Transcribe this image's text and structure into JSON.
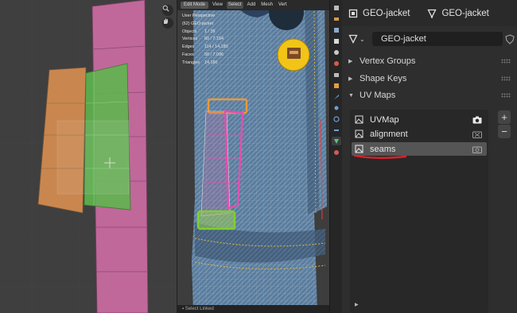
{
  "viewport": {
    "mode": "Edit Mode",
    "menus": [
      "View",
      "Select",
      "Add",
      "Mesh",
      "Vert"
    ],
    "overlay_title": "User Perspective",
    "overlay_object": "(62) GEO-jacket",
    "stats": [
      {
        "label": "Objects",
        "value": "1 / 39"
      },
      {
        "label": "Vertices",
        "value": "60 / 7,154"
      },
      {
        "label": "Edges",
        "value": "114 / 14,180"
      },
      {
        "label": "Faces",
        "value": "58 / 7,096"
      },
      {
        "label": "Triangles",
        "value": "14,180"
      }
    ],
    "footer": "Select Linked"
  },
  "properties": {
    "header_object": "GEO-jacket",
    "header_data": "GEO-jacket",
    "mesh_name": "GEO-jacket",
    "panels": [
      {
        "label": "Vertex Groups",
        "expanded": false
      },
      {
        "label": "Shape Keys",
        "expanded": false
      },
      {
        "label": "UV Maps",
        "expanded": true
      }
    ],
    "uv_maps": [
      {
        "name": "UVMap",
        "active_render": true
      },
      {
        "name": "alignment",
        "active_render": false
      },
      {
        "name": "seams",
        "active_render": false,
        "selected": true
      }
    ],
    "add_label": "+",
    "remove_label": "−"
  },
  "colors": {
    "uv_orange": "#c9874f",
    "uv_green": "#5fb54f",
    "uv_pink": "#c0689a",
    "annotation_red": "#e0202a",
    "pin_yellow": "#f1c417"
  },
  "icons": {
    "header_object": "object-icon",
    "header_data": "mesh-data-icon",
    "zoom": "zoom-icon",
    "pan": "hand-icon",
    "uv_map": "uv-map-icon",
    "render_active": "camera-icon"
  }
}
